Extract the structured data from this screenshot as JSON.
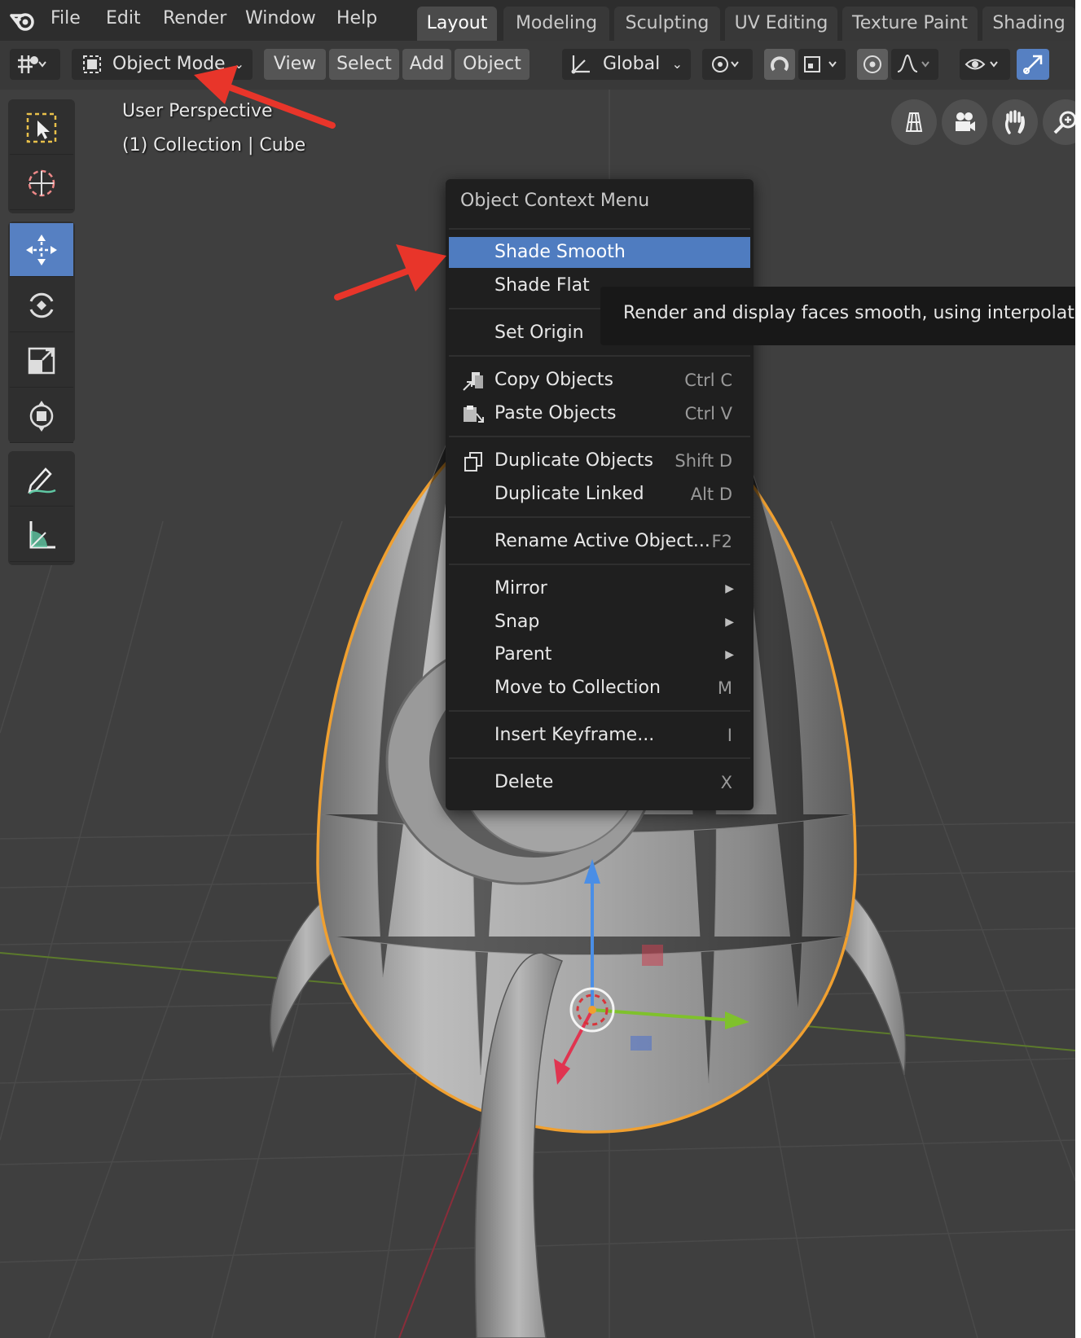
{
  "menubar": {
    "items": [
      "File",
      "Edit",
      "Render",
      "Window",
      "Help"
    ],
    "workspace_tabs": [
      {
        "label": "Layout",
        "active": true
      },
      {
        "label": "Modeling",
        "active": false
      },
      {
        "label": "Sculpting",
        "active": false
      },
      {
        "label": "UV Editing",
        "active": false
      },
      {
        "label": "Texture Paint",
        "active": false
      },
      {
        "label": "Shading",
        "active": false
      }
    ]
  },
  "header": {
    "mode_label": "Object Mode",
    "menus": [
      "View",
      "Select",
      "Add",
      "Object"
    ],
    "transform_orientation": "Global"
  },
  "viewport": {
    "view_name": "User Perspective",
    "collection_info": "(1) Collection | Cube"
  },
  "context_menu": {
    "title": "Object Context Menu",
    "items": [
      {
        "label": "Shade Smooth",
        "shortcut": "",
        "highlighted": true
      },
      {
        "label": "Shade Flat",
        "shortcut": ""
      },
      {
        "label": "Set Origin",
        "shortcut": ""
      },
      {
        "label": "Copy Objects",
        "shortcut": "Ctrl C",
        "icon": "copy-objects-icon"
      },
      {
        "label": "Paste Objects",
        "shortcut": "Ctrl V",
        "icon": "paste-objects-icon"
      },
      {
        "label": "Duplicate Objects",
        "shortcut": "Shift D",
        "icon": "duplicate-icon"
      },
      {
        "label": "Duplicate Linked",
        "shortcut": "Alt D"
      },
      {
        "label": "Rename Active Object...",
        "shortcut": "F2"
      },
      {
        "label": "Mirror",
        "submenu": true
      },
      {
        "label": "Snap",
        "submenu": true
      },
      {
        "label": "Parent",
        "submenu": true
      },
      {
        "label": "Move to Collection",
        "shortcut": "M"
      },
      {
        "label": "Insert Keyframe...",
        "shortcut": "I"
      },
      {
        "label": "Delete",
        "shortcut": "X"
      }
    ]
  },
  "tooltip": {
    "text": "Render and display faces smooth, using interpolated Ve"
  },
  "colors": {
    "highlight": "#4f7cc0",
    "active_tool": "#5680c2",
    "selection_outline": "#f0a030",
    "annotation_arrow": "#e8352a"
  }
}
